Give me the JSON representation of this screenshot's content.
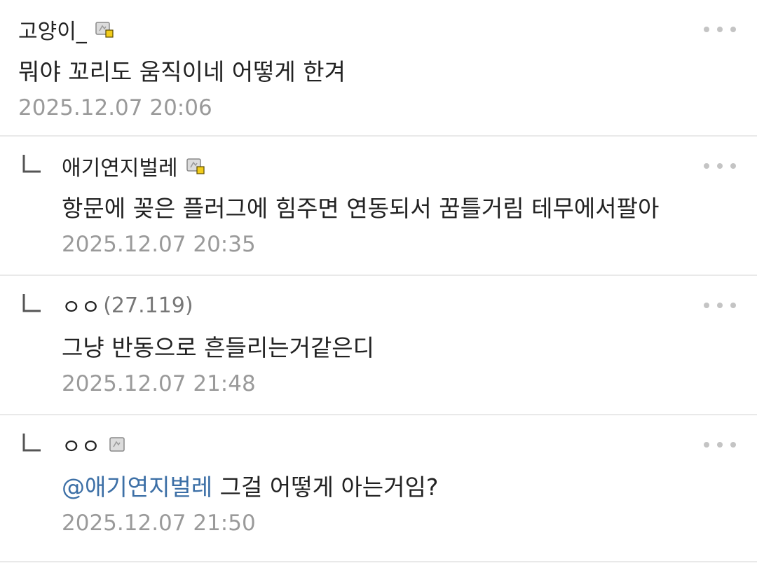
{
  "comments": [
    {
      "nick": "고양이_",
      "ip": "",
      "body_mention": "",
      "body": "뭐야 꼬리도 움직이네 어떻게 한겨",
      "date": "2025.12.07 20:06",
      "badge_icon": "fixed-nick-icon",
      "reply": false
    },
    {
      "nick": "애기연지벌레",
      "ip": "",
      "body_mention": "",
      "body": "항문에 꽂은 플러그에 힘주면 연동되서 꿈틀거림 테무에서팔아",
      "date": "2025.12.07 20:35",
      "badge_icon": "fixed-nick-icon",
      "reply": true
    },
    {
      "nick": "ㅇㅇ",
      "ip": "(27.119)",
      "body_mention": "",
      "body": "그냥 반동으로 흔들리는거같은디",
      "date": "2025.12.07 21:48",
      "badge_icon": "",
      "reply": true
    },
    {
      "nick": "ㅇㅇ",
      "ip": "",
      "body_mention": "@애기연지벌레",
      "body": " 그걸 어떻게 아는거임?",
      "date": "2025.12.07 21:50",
      "badge_icon": "semi-fixed-nick-icon",
      "reply": true
    }
  ],
  "colors": {
    "mention": "#3c6fa6",
    "date": "#9a9a9a",
    "badge_yellow": "#f2cc1a"
  },
  "icons": {
    "more": "more-dots-icon",
    "reply": "reply-arrow-icon"
  }
}
